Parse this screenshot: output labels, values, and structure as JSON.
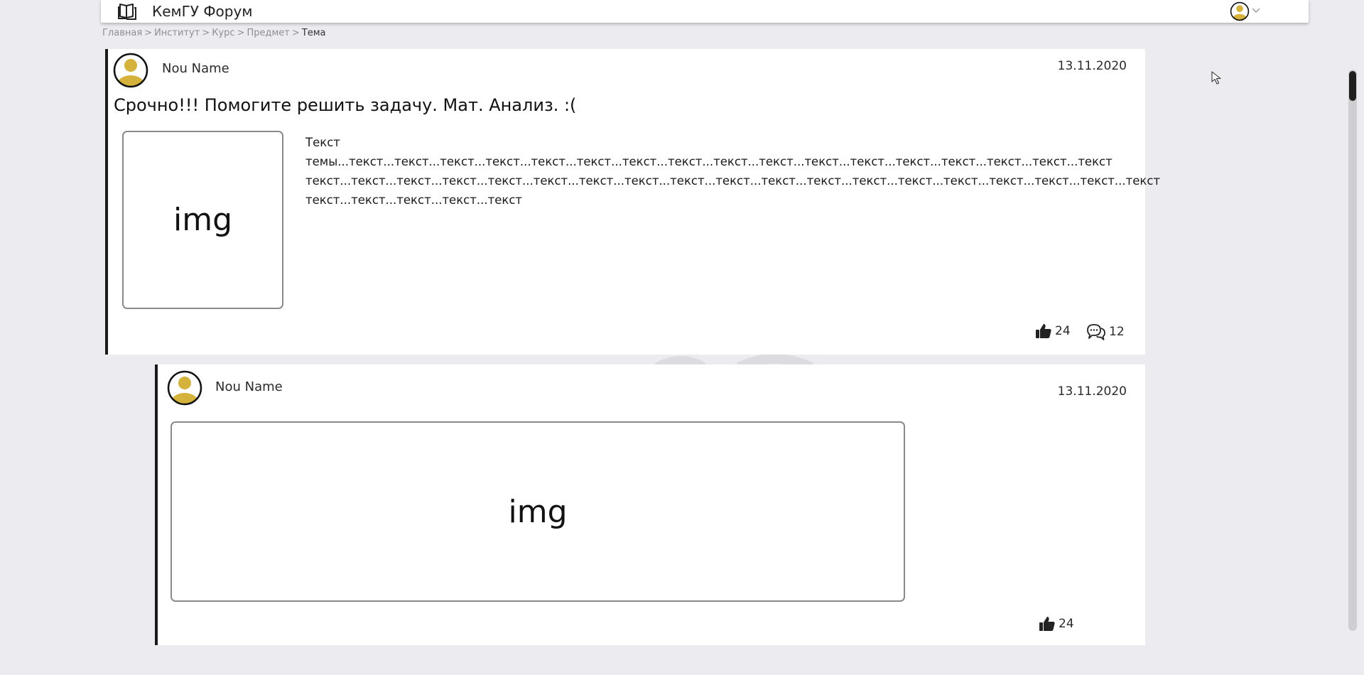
{
  "app": {
    "title": "КемГУ Форум"
  },
  "breadcrumb": {
    "items": [
      "Главная",
      "Институт",
      "Курс",
      "Предмет"
    ],
    "separator": ">",
    "current": "Тема"
  },
  "topic": {
    "author": "Nou Name",
    "date": "13.11.2020",
    "title": "Срочно!!! Помогите решить задачу. Мат. Анализ. :(",
    "image_label": "img",
    "text": "Текст темы...текст...текст...текст...текст...текст...текст...текст...текст...текст...текст...текст...текст...текст...текст...текст...текст...текст текст...текст...текст...текст...текст...текст...текст...текст...текст...текст...текст...текст...текст...текст...текст...текст...текст...текст...текст текст...текст...текст...текст...текст",
    "likes": "24",
    "comments": "12"
  },
  "reply": {
    "author": "Nou Name",
    "date": "13.11.2020",
    "image_label": "img",
    "likes": "24"
  },
  "icons": {
    "logo": "book-logo-icon",
    "avatar": "user-avatar-icon",
    "like": "thumbs-up-icon",
    "comment": "comment-bubbles-icon",
    "chevron": "chevron-down-icon"
  },
  "colors": {
    "background": "#ececf0",
    "card": "#ffffff",
    "card_accent": "#1a1a1a",
    "avatar_gold": "#d4b23c"
  }
}
